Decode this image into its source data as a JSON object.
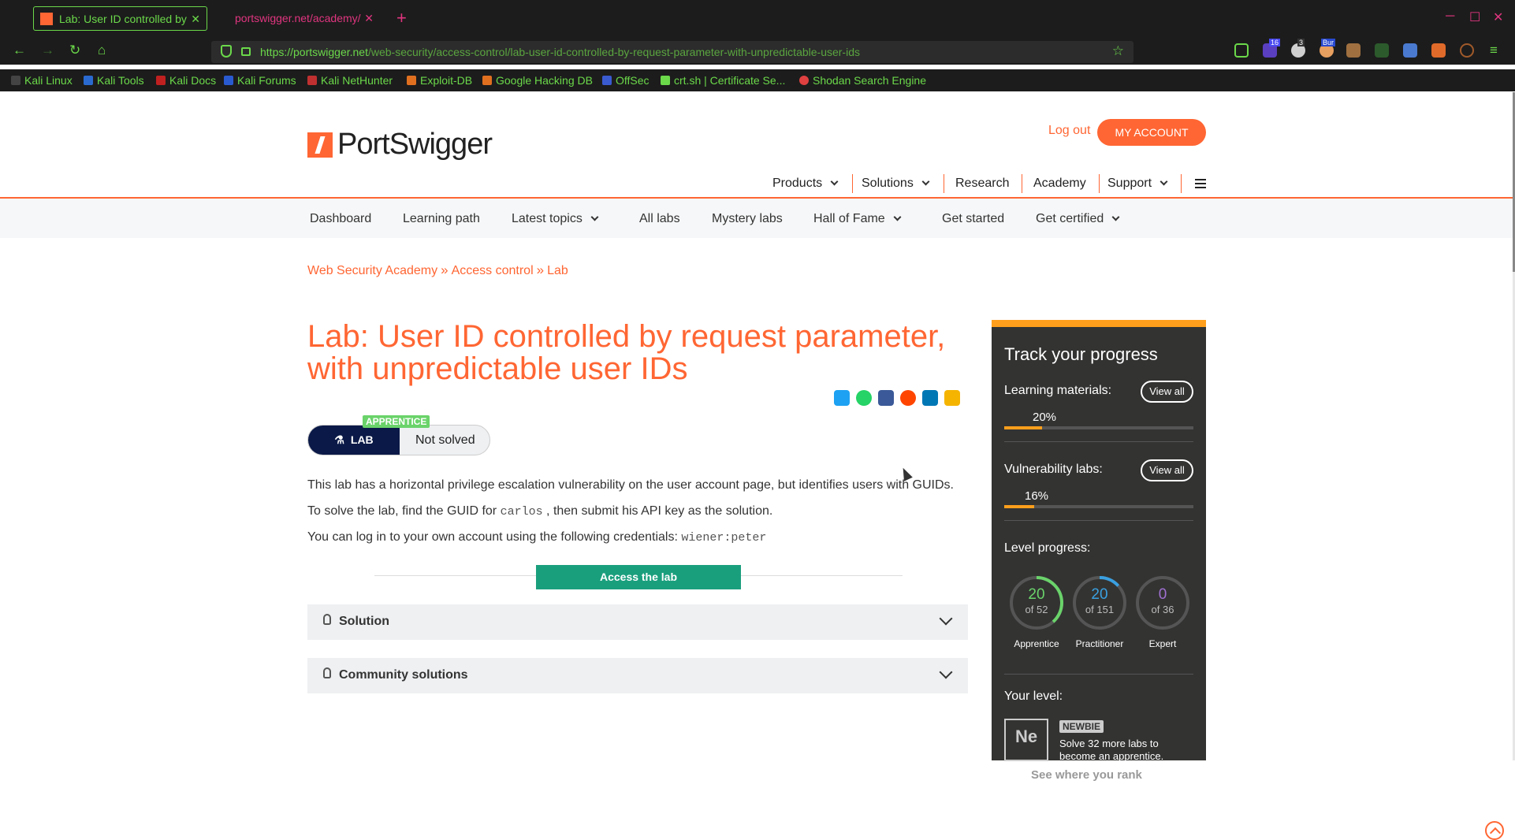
{
  "browser": {
    "tabs": [
      {
        "title": "Lab: User ID controlled by"
      },
      {
        "title": "portswigger.net/academy/"
      }
    ],
    "url_host": "https://portswigger.net",
    "url_path": "/web-security/access-control/lab-user-id-controlled-by-request-parameter-with-unpredictable-user-ids",
    "ext_badges": [
      "16",
      "3",
      "Bur"
    ],
    "bookmarks": [
      "Kali Linux",
      "Kali Tools",
      "Kali Docs",
      "Kali Forums",
      "Kali NetHunter",
      "Exploit-DB",
      "Google Hacking DB",
      "OffSec",
      "crt.sh | Certificate Se...",
      "Shodan Search Engine"
    ]
  },
  "header": {
    "logo_text": "PortSwigger",
    "logout": "Log out",
    "my_account": "MY ACCOUNT",
    "nav": [
      "Products",
      "Solutions",
      "Research",
      "Academy",
      "Support"
    ]
  },
  "subnav": [
    "Dashboard",
    "Learning path",
    "Latest topics",
    "All labs",
    "Mystery labs",
    "Hall of Fame",
    "Get started",
    "Get certified"
  ],
  "breadcrumb": [
    "Web Security Academy",
    "Access control",
    "Lab"
  ],
  "lab": {
    "title": "Lab: User ID controlled by request parameter, with unpredictable user IDs",
    "level_badge": "APPRENTICE",
    "lab_label": "LAB",
    "status": "Not solved",
    "desc1": "This lab has a horizontal privilege escalation vulnerability on the user account page, but identifies users with GUIDs.",
    "desc2a": "To solve the lab, find the GUID for",
    "desc2code": "carlos",
    "desc2b": ", then submit his API key as the solution.",
    "desc3a": "You can log in to your own account using the following credentials:",
    "desc3code": "wiener:peter",
    "access": "Access the lab",
    "solution": "Solution",
    "community": "Community solutions"
  },
  "progress": {
    "title": "Track your progress",
    "learning_label": "Learning materials:",
    "learning_pct": "20%",
    "learning_value": 0.2,
    "vuln_label": "Vulnerability labs:",
    "vuln_pct": "16%",
    "vuln_value": 0.16,
    "view_all": "View all",
    "level_label": "Level progress:",
    "levels": [
      {
        "num": "20",
        "of": "of 52",
        "name": "Apprentice",
        "color": "#6ad36a",
        "value": 0.385
      },
      {
        "num": "20",
        "of": "of 151",
        "name": "Practitioner",
        "color": "#3aa0e0",
        "value": 0.132
      },
      {
        "num": "0",
        "of": "of 36",
        "name": "Expert",
        "color": "#a070d0",
        "value": 0
      }
    ],
    "your_level": "Your level:",
    "level_symbol": "Ne",
    "newbie": "NEWBIE",
    "solve_text": "Solve 32 more labs to become an apprentice.",
    "see_where": "See where you rank"
  },
  "colors": {
    "accent": "#ff6633",
    "progress": "#ff9f1c",
    "lab_dark": "#0a1947",
    "access": "#1a9f7d"
  }
}
